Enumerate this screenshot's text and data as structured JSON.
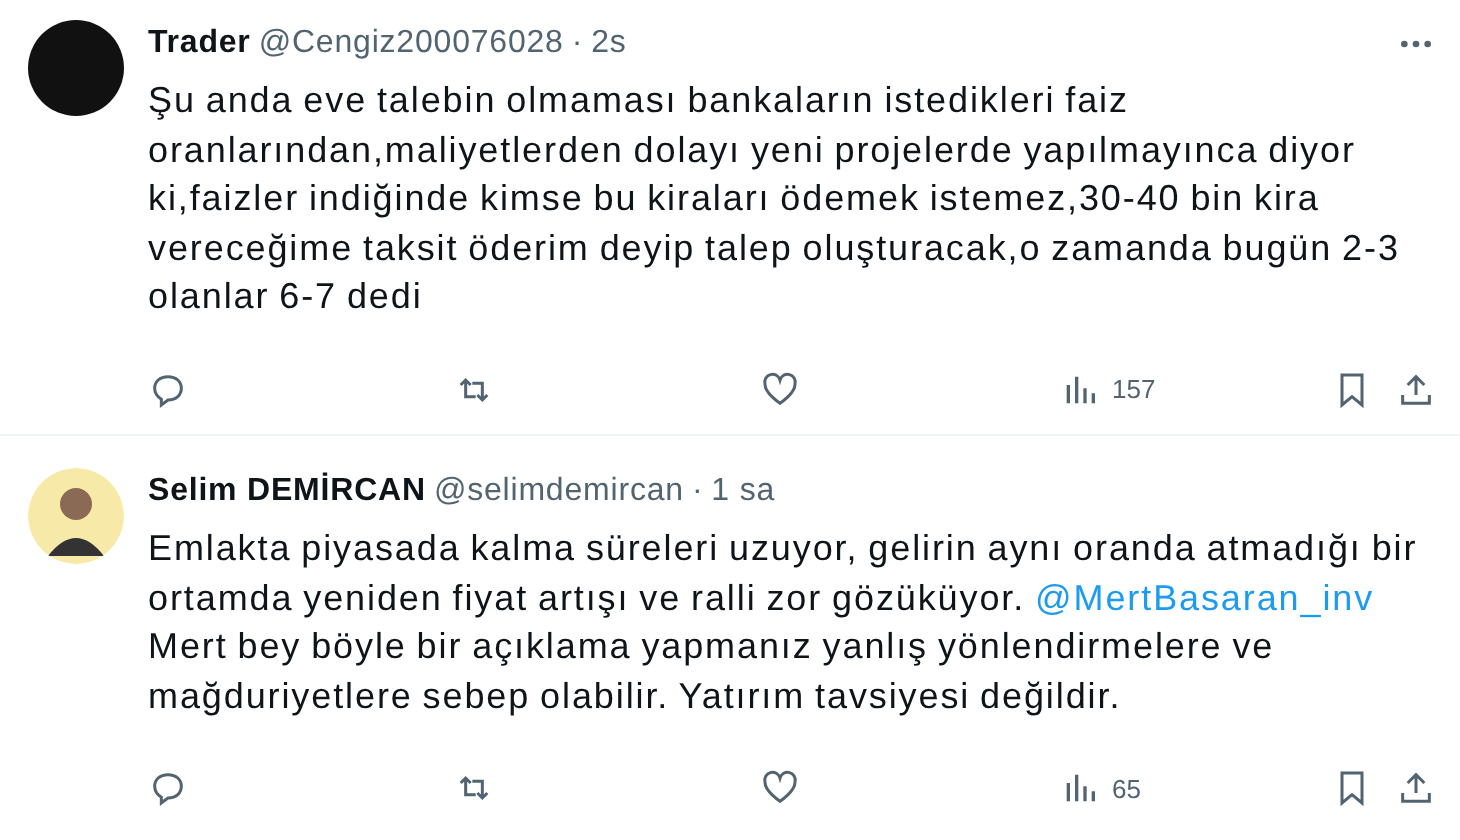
{
  "tweets": [
    {
      "name": "Trader",
      "handle": "@Cengiz200076028",
      "separator": "·",
      "time": "2s",
      "avatar": {
        "kind": "photo"
      },
      "more_menu": true,
      "body": [
        {
          "kind": "text",
          "text": "Şu anda eve talebin olmaması bankaların istedikleri faiz oranlarından,maliyetlerden dolayı yeni projelerde yapılmayınca diyor ki,faizler indiğinde kimse bu kiraları ödemek istemez,30-40 bin kira vereceğime taksit öderim deyip talep oluşturacak,o zamanda bugün 2-3 olanlar 6-7 dedi"
        }
      ],
      "views": "157"
    },
    {
      "name": "Selim DEMİRCAN",
      "handle": "@selimdemircan",
      "separator": "·",
      "time": "1 sa",
      "avatar": {
        "kind": "person"
      },
      "more_menu": false,
      "body": [
        {
          "kind": "text",
          "text": "Emlakta piyasada kalma süreleri uzuyor, gelirin aynı oranda atmadığı bir ortamda yeniden fiyat artışı ve ralli zor gözüküyor. "
        },
        {
          "kind": "mention",
          "text": "@MertBasaran_inv"
        },
        {
          "kind": "text",
          "text": " Mert bey böyle bir açıklama yapmanız yanlış yönlendirmelere ve mağduriyetlere sebep olabilir. Yatırım tavsiyesi değildir."
        }
      ],
      "views": "65"
    }
  ]
}
